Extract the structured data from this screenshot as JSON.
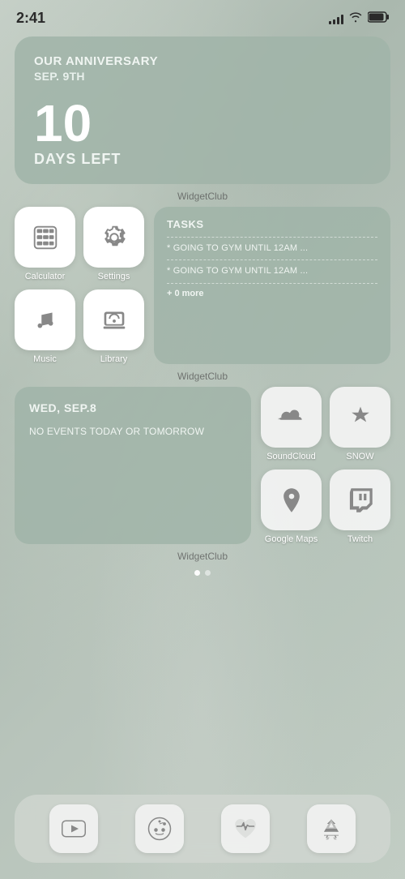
{
  "status": {
    "time": "2:41",
    "signal": [
      3,
      5,
      7,
      9,
      11
    ],
    "wifi": "wifi",
    "battery": "battery"
  },
  "anniversary_widget": {
    "title": "Our anniversary",
    "date": "Sep. 9th",
    "days_number": "10",
    "days_label": "Days left",
    "widget_club": "WidgetClub"
  },
  "apps": {
    "calculator": "Calculator",
    "settings": "Settings",
    "music": "Music",
    "library": "Library"
  },
  "tasks_widget": {
    "title": "Tasks",
    "task1": "* Going to Gym Until 12am ...",
    "task2": "* Going to Gym Until 12am ...",
    "more": "+ 0 more",
    "widget_club": "WidgetClub"
  },
  "calendar_widget": {
    "day": "Wed, Sep.8",
    "event": "No events today or tomorrow",
    "widget_club": "WidgetClub"
  },
  "app_icons": {
    "soundcloud": "SoundCloud",
    "snow": "SNOW",
    "google_maps": "Google Maps",
    "twitch": "Twitch"
  },
  "dock": {
    "youtube": "YouTube",
    "reddit": "Reddit",
    "health": "Health",
    "appstore": "App Store"
  },
  "page_dots": {
    "active": 0,
    "total": 2
  }
}
